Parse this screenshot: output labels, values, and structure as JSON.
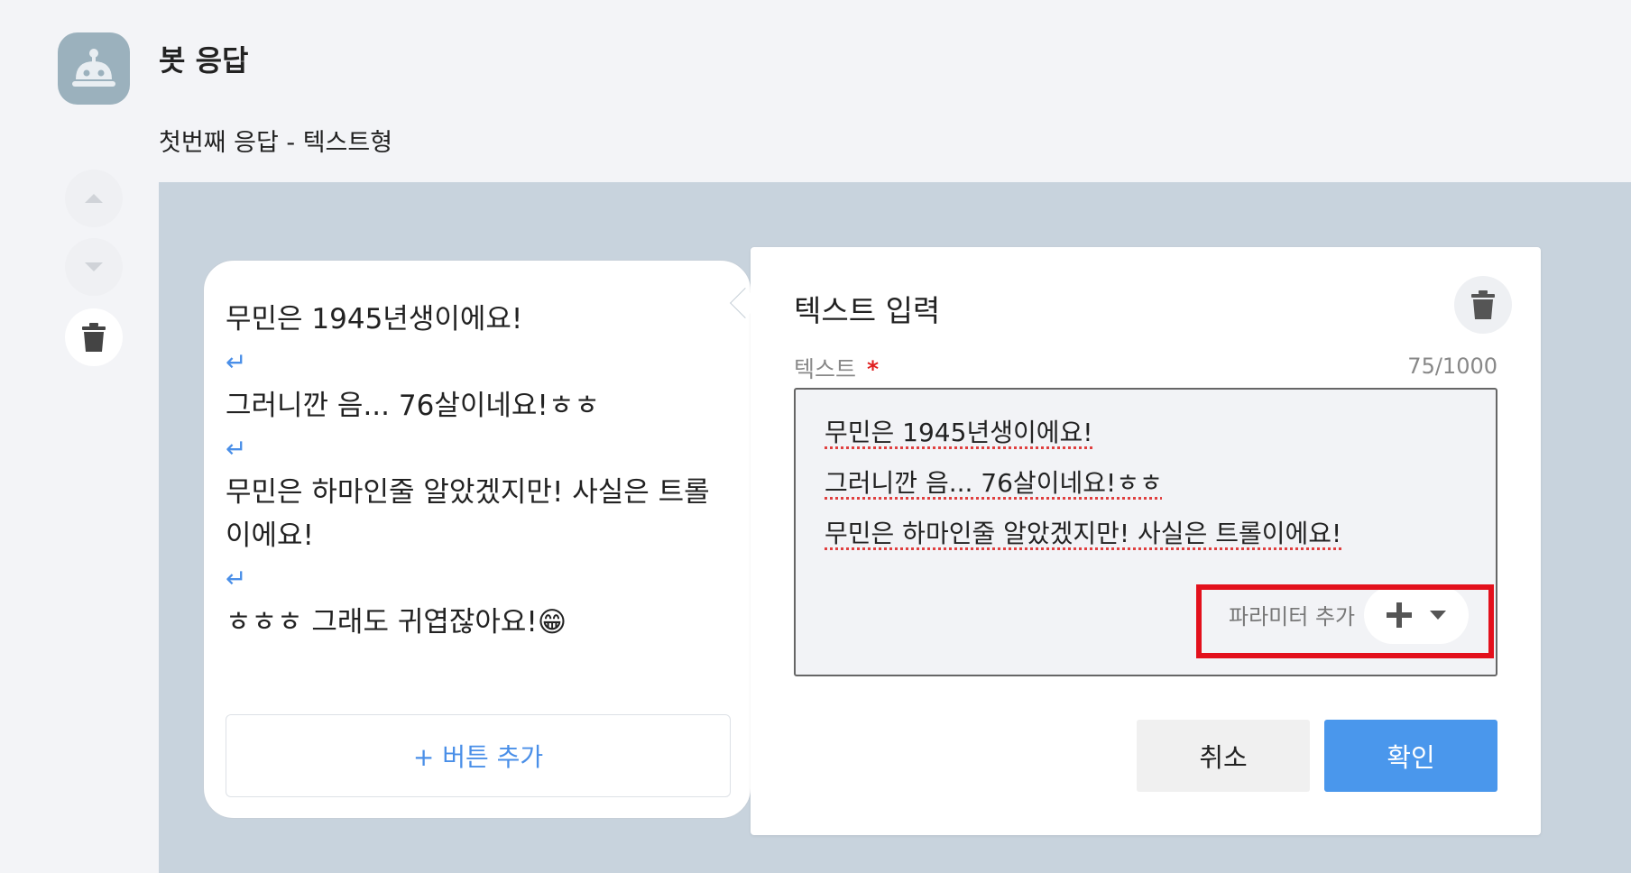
{
  "header": {
    "title": "봇 응답",
    "subtitle": "첫번째 응답 - 텍스트형"
  },
  "sidebar": {
    "icons": [
      "chevron-up-icon",
      "chevron-down-icon",
      "trash-icon"
    ]
  },
  "bubble": {
    "lines": [
      "무민은 1945년생이에요!",
      "그러니깐 음... 76살이네요!ㅎㅎ",
      "무민은 하마인줄 알았겠지만! 사실은 트롤이에요!",
      "ㅎㅎㅎ 그래도 귀엽잖아요!😁"
    ],
    "return_symbol": "↵",
    "add_button_label": "+ 버튼 추가"
  },
  "editor": {
    "title": "텍스트 입력",
    "field_label": "텍스트",
    "required_mark": "*",
    "counter": "75/1000",
    "lines": [
      "무민은 1945년생이에요!",
      "그러니깐 음... 76살이네요!ㅎㅎ",
      "무민은 하마인줄 알았겠지만! 사실은 트롤이에요!"
    ],
    "param_label": "파라미터 추가",
    "cancel_label": "취소",
    "confirm_label": "확인"
  },
  "colors": {
    "accent": "#4a97ec",
    "highlight": "#e3101c",
    "area_bg": "#c8d3dd"
  }
}
